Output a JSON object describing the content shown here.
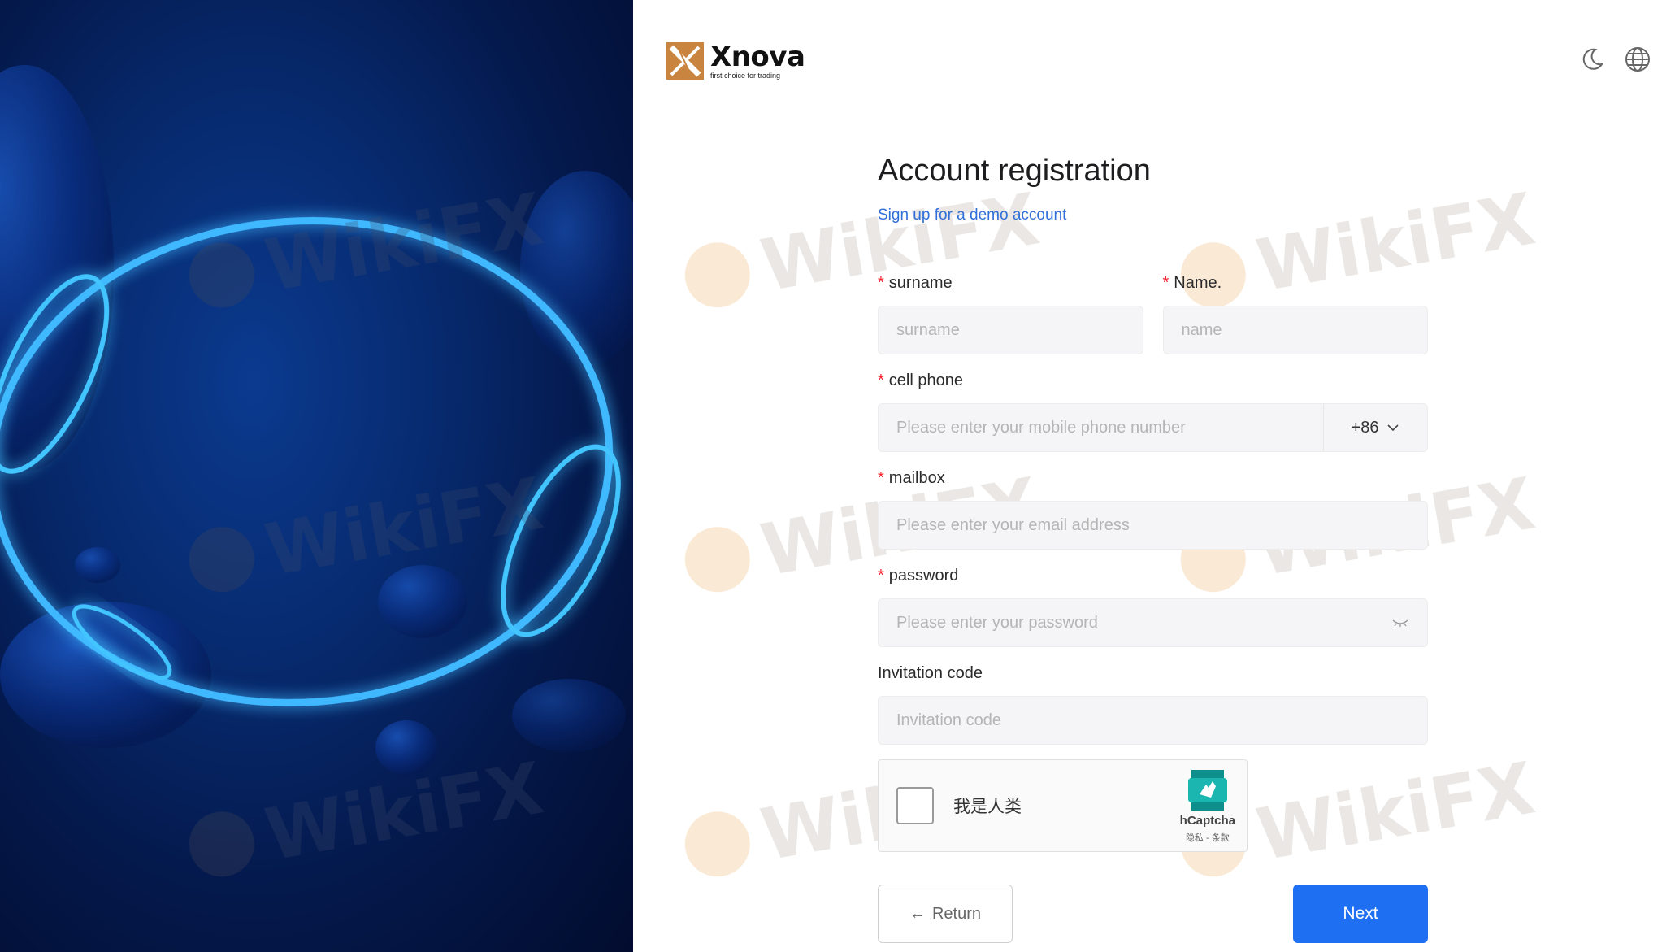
{
  "brand": {
    "name": "Xnova",
    "tagline": "first choice for trading"
  },
  "header": {
    "theme_icon": "moon-icon",
    "language_icon": "globe-icon"
  },
  "form": {
    "title": "Account registration",
    "subtitle": "Sign up for a demo account",
    "required_mark": "*",
    "surname": {
      "label": "surname",
      "placeholder": "surname"
    },
    "name": {
      "label": "Name.",
      "placeholder": "name"
    },
    "phone": {
      "label": "cell phone",
      "placeholder": "Please enter your mobile phone number",
      "country_code": "+86"
    },
    "mailbox": {
      "label": "mailbox",
      "placeholder": "Please enter your email address"
    },
    "password": {
      "label": "password",
      "placeholder": "Please enter your password"
    },
    "invitation": {
      "label": "Invitation code",
      "placeholder": "Invitation code"
    },
    "captcha": {
      "label": "我是人类",
      "brand": "hCaptcha",
      "links": "隐私 - 条款"
    },
    "return_label": "Return",
    "next_label": "Next"
  },
  "watermark": {
    "text": "WikiFX"
  },
  "colors": {
    "primary": "#1f6ff2",
    "link": "#2f6fd8",
    "required": "#f5222d",
    "hero_dark": "#020c2e",
    "ring": "#3fb8ff"
  }
}
